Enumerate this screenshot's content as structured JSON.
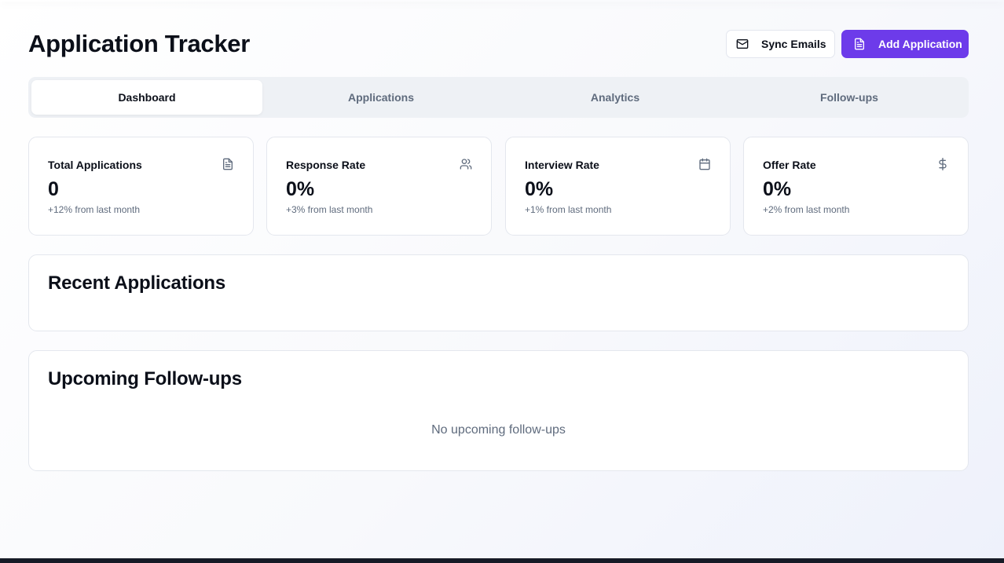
{
  "app": {
    "title": "Application Tracker"
  },
  "header": {
    "sync_label": "Sync Emails",
    "add_label": "Add Application"
  },
  "tabs": [
    {
      "label": "Dashboard",
      "active": true
    },
    {
      "label": "Applications",
      "active": false
    },
    {
      "label": "Analytics",
      "active": false
    },
    {
      "label": "Follow-ups",
      "active": false
    }
  ],
  "stats": [
    {
      "label": "Total Applications",
      "value": "0",
      "change": "+12% from last month",
      "icon": "file-text-icon"
    },
    {
      "label": "Response Rate",
      "value": "0%",
      "change": "+3% from last month",
      "icon": "users-icon"
    },
    {
      "label": "Interview Rate",
      "value": "0%",
      "change": "+1% from last month",
      "icon": "calendar-icon"
    },
    {
      "label": "Offer Rate",
      "value": "0%",
      "change": "+2% from last month",
      "icon": "dollar-icon"
    }
  ],
  "recent": {
    "title": "Recent Applications"
  },
  "followups": {
    "title": "Upcoming Follow-ups",
    "empty_text": "No upcoming follow-ups"
  },
  "colors": {
    "accent": "#6d3bea",
    "text": "#0b0f19",
    "muted": "#5f6b7d",
    "tab_bg": "#eef1f5"
  }
}
